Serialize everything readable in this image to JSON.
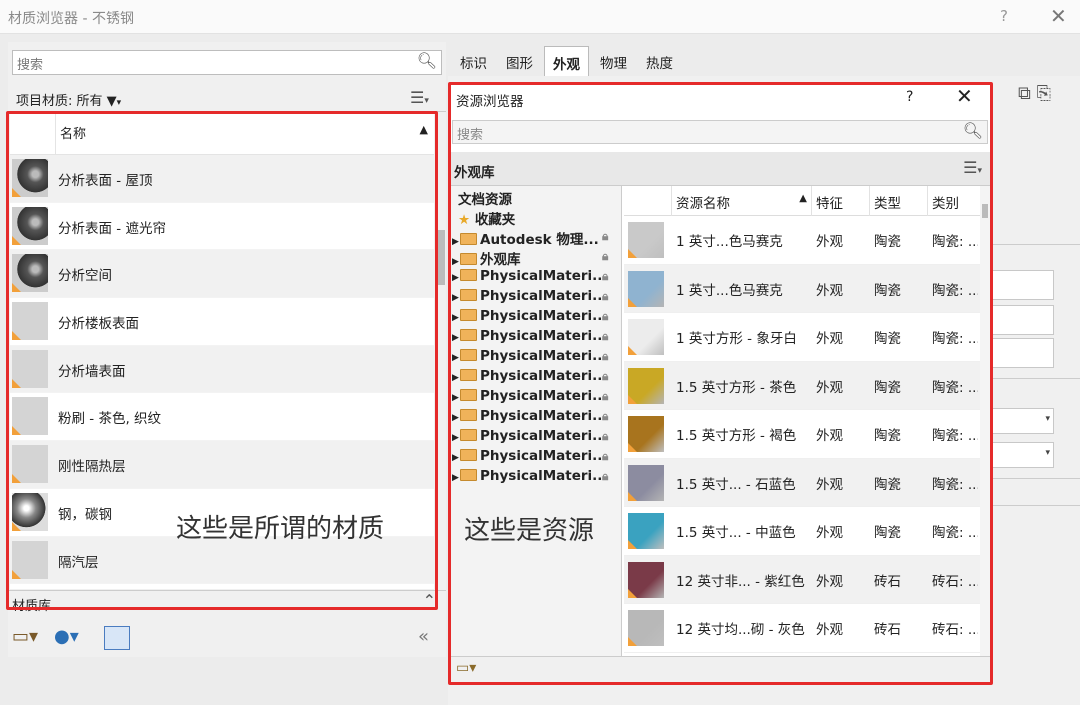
{
  "window": {
    "title": "材质浏览器 - 不锈钢",
    "help": "?",
    "close": "✕"
  },
  "left": {
    "search_placeholder": "搜索",
    "filter_label": "项目材质: 所有",
    "column_name": "名称",
    "materials": [
      {
        "name": "分析表面 - 屋顶",
        "thumb": "sphere"
      },
      {
        "name": "分析表面 - 遮光帘",
        "thumb": "sphere"
      },
      {
        "name": "分析空间",
        "thumb": "sphere"
      },
      {
        "name": "分析楼板表面",
        "thumb": "flat"
      },
      {
        "name": "分析墙表面",
        "thumb": "flat"
      },
      {
        "name": "粉刷 - 茶色, 织纹",
        "thumb": "flat"
      },
      {
        "name": "刚性隔热层",
        "thumb": "flat"
      },
      {
        "name": "钢，碳钢",
        "thumb": "steel"
      },
      {
        "name": "隔汽层",
        "thumb": "flat"
      }
    ],
    "library_label": "材质库",
    "annotation": "这些是所谓的材质"
  },
  "tabs": [
    "标识",
    "图形",
    "外观",
    "物理",
    "热度"
  ],
  "active_tab": "外观",
  "assets": {
    "title": "资源浏览器",
    "help": "?",
    "close": "✕",
    "search_placeholder": "搜索",
    "library_title": "外观库",
    "tree": [
      {
        "label": "文档资源",
        "kind": "header"
      },
      {
        "label": "收藏夹",
        "kind": "star"
      },
      {
        "label": "Autodesk 物理...",
        "kind": "folder"
      },
      {
        "label": "外观库",
        "kind": "folder"
      },
      {
        "label": "PhysicalMateri...",
        "kind": "folder"
      },
      {
        "label": "PhysicalMateri...",
        "kind": "folder"
      },
      {
        "label": "PhysicalMateri...",
        "kind": "folder"
      },
      {
        "label": "PhysicalMateri...",
        "kind": "folder"
      },
      {
        "label": "PhysicalMateri...",
        "kind": "folder"
      },
      {
        "label": "PhysicalMateri...",
        "kind": "folder"
      },
      {
        "label": "PhysicalMateri...",
        "kind": "folder"
      },
      {
        "label": "PhysicalMateri...",
        "kind": "folder"
      },
      {
        "label": "PhysicalMateri...",
        "kind": "folder"
      },
      {
        "label": "PhysicalMateri...",
        "kind": "folder"
      },
      {
        "label": "PhysicalMateri...",
        "kind": "folder"
      }
    ],
    "columns": [
      "资源名称",
      "特征",
      "类型",
      "类别"
    ],
    "rows": [
      {
        "name": "1 英寸...色马赛克",
        "feature": "外观",
        "type": "陶瓷",
        "category": "陶瓷: ...",
        "color": "#c9c9c9"
      },
      {
        "name": "1 英寸...色马赛克",
        "feature": "外观",
        "type": "陶瓷",
        "category": "陶瓷: ...",
        "color": "#8fb3d0"
      },
      {
        "name": "1 英寸方形 - 象牙白",
        "feature": "外观",
        "type": "陶瓷",
        "category": "陶瓷: ...",
        "color": "#ececec"
      },
      {
        "name": "1.5 英寸方形 - 茶色",
        "feature": "外观",
        "type": "陶瓷",
        "category": "陶瓷: ...",
        "color": "#c9a825"
      },
      {
        "name": "1.5 英寸方形 - 褐色",
        "feature": "外观",
        "type": "陶瓷",
        "category": "陶瓷: ...",
        "color": "#a8741e"
      },
      {
        "name": "1.5 英寸... - 石蓝色",
        "feature": "外观",
        "type": "陶瓷",
        "category": "陶瓷: ...",
        "color": "#8c8ca0"
      },
      {
        "name": "1.5 英寸... - 中蓝色",
        "feature": "外观",
        "type": "陶瓷",
        "category": "陶瓷: ...",
        "color": "#3aa2c0"
      },
      {
        "name": "12 英寸非... - 紫红色",
        "feature": "外观",
        "type": "砖石",
        "category": "砖石: ...",
        "color": "#7a3a48"
      },
      {
        "name": "12 英寸均...砌 - 灰色",
        "feature": "外观",
        "type": "砖石",
        "category": "砖石: ...",
        "color": "#b8b8b8"
      }
    ],
    "annotation": "这些是资源"
  },
  "colors": {
    "highlight": "#e52a2a",
    "warning": "#f2a03a"
  }
}
